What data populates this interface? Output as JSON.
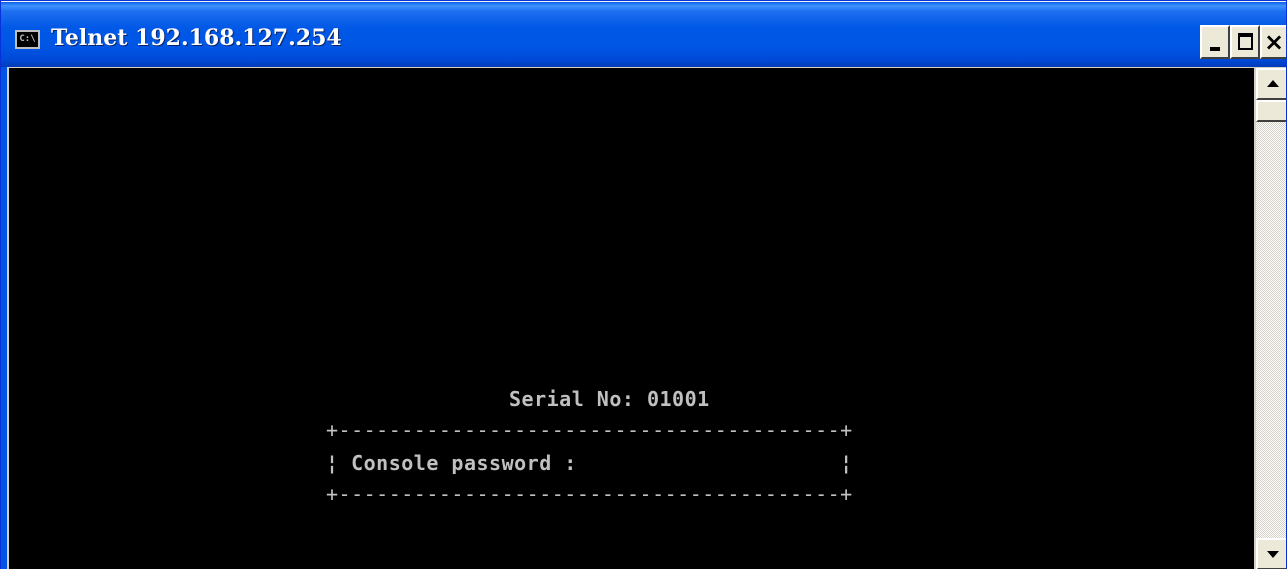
{
  "window": {
    "title": "Telnet 192.168.127.254",
    "icon": "console-icon",
    "icon_text": "C:\\",
    "controls": {
      "minimize": "minimize-icon",
      "maximize": "maximize-icon",
      "close": "close-icon",
      "close_glyph": "×"
    }
  },
  "terminal": {
    "background": "#000000",
    "foreground": "#c0c0c0",
    "serial_line": "Serial No: 01001",
    "box_top": "+----------------------------------------+",
    "prompt_line": "¦ Console password :                     ¦",
    "box_bottom": "+----------------------------------------+"
  },
  "scrollbar": {
    "up_icon": "arrow-up-icon",
    "down_icon": "arrow-down-icon"
  }
}
